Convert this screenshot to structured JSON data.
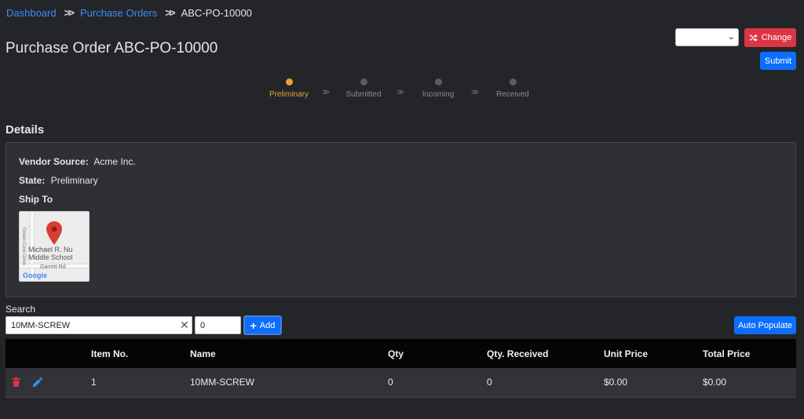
{
  "breadcrumb": {
    "items": [
      "Dashboard",
      "Purchase Orders"
    ],
    "current": "ABC-PO-10000"
  },
  "page": {
    "title": "Purchase Order ABC-PO-10000"
  },
  "actions": {
    "select_value": "",
    "change_label": "Change",
    "submit_label": "Submit"
  },
  "stepper": {
    "steps": [
      "Preliminary",
      "Submitted",
      "Incoming",
      "Received"
    ],
    "active_index": 0
  },
  "details": {
    "section_title": "Details",
    "vendor_source_label": "Vendor Source:",
    "vendor_source_value": "Acme Inc.",
    "state_label": "State:",
    "state_value": "Preliminary",
    "ship_to_label": "Ship To",
    "map": {
      "place_name": "Michael R. Nu Middle School",
      "road_label": "Garrett Rd",
      "side_road_label": "Green Cove Drive",
      "logo": "Google"
    }
  },
  "search": {
    "label": "Search",
    "value": "10MM-SCREW",
    "quantity_value": "0",
    "add_label": "Add",
    "auto_populate_label": "Auto Populate"
  },
  "table": {
    "columns": [
      "",
      "Item No.",
      "Name",
      "Qty",
      "Qty. Received",
      "Unit Price",
      "Total Price"
    ],
    "rows": [
      {
        "item_no": "1",
        "name": "10MM-SCREW",
        "qty": "0",
        "qty_received": "0",
        "unit_price": "$0.00",
        "total_price": "$0.00"
      }
    ]
  },
  "colors": {
    "background": "#242529",
    "link": "#3d8bfd",
    "danger": "#dc3545",
    "primary": "#0d6efd",
    "step_active": "#e8a03c"
  },
  "icons": {
    "breadcrumb_separator": "double-chevron-right-icon",
    "change_button": "shuffle-icon",
    "add_button": "plus-icon",
    "delete": "trash-icon",
    "edit": "pencil-icon",
    "clear": "close-icon",
    "map_pin": "map-pin-icon"
  }
}
